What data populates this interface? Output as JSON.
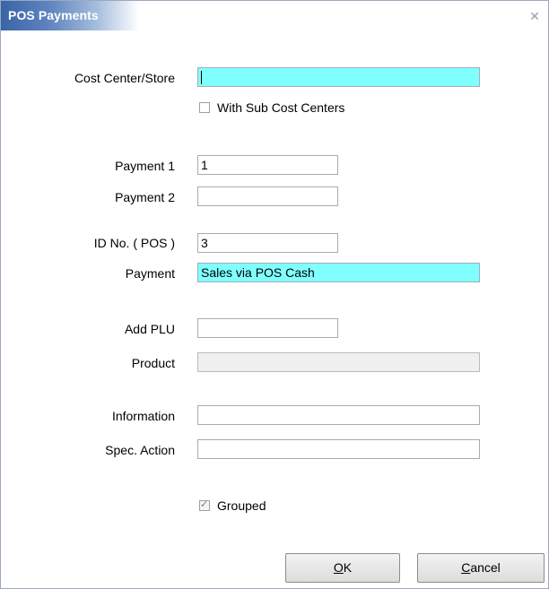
{
  "window": {
    "title": "POS Payments",
    "close_icon": "close-icon"
  },
  "form": {
    "cost_center_label": "Cost Center/Store",
    "cost_center_value": "",
    "with_sub_cost_centers_label": "With Sub Cost Centers",
    "with_sub_cost_centers_checked": false,
    "payment1_label": "Payment 1",
    "payment1_value": "1",
    "payment2_label": "Payment 2",
    "payment2_value": "",
    "id_no_label": "ID No. ( POS )",
    "id_no_value": "3",
    "payment_label": "Payment",
    "payment_value": "Sales via POS Cash",
    "add_plu_label": "Add PLU",
    "add_plu_value": "",
    "product_label": "Product",
    "product_value": "",
    "information_label": "Information",
    "information_value": "",
    "spec_action_label": "Spec. Action",
    "spec_action_value": "",
    "grouped_label": "Grouped",
    "grouped_checked": true
  },
  "buttons": {
    "ok_mnemonic": "O",
    "ok_rest": "K",
    "cancel_mnemonic": "C",
    "cancel_rest": "ancel"
  },
  "colors": {
    "title_accent": "#3a64a6",
    "highlight_field": "#80ffff"
  }
}
